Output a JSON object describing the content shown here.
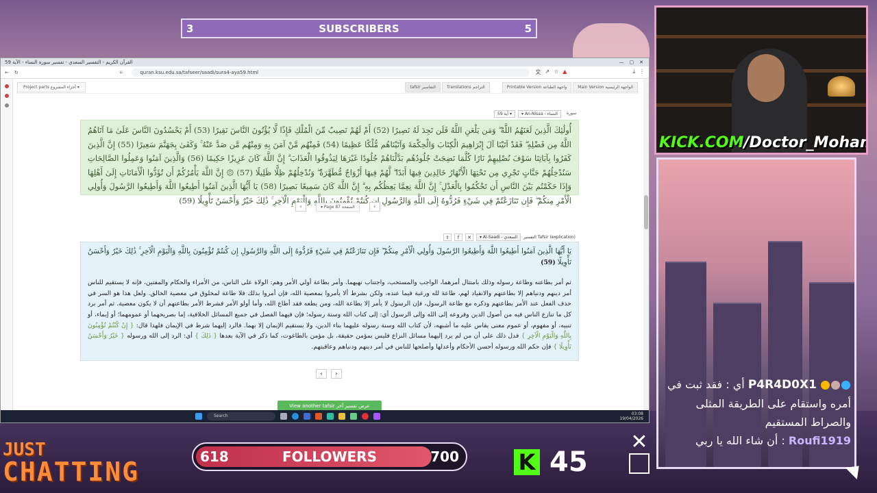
{
  "overlay": {
    "subscribers": {
      "current": "3",
      "label": "SUBSCRIBERS",
      "goal": "5"
    },
    "followers": {
      "current": "618",
      "label": "FOLLOWERS",
      "goal": "700",
      "progress": 0.883
    },
    "just_chatting": {
      "line1": "JUST",
      "line2": "CHATTING"
    },
    "viewer_count": "45",
    "webcam_handle": {
      "kick": "KICK.COM",
      "name": "/Doctor_Mohamed"
    },
    "chat": [
      {
        "user": "P4R4D0X1",
        "message": "أي : فقد ثبت في أمره واستقام على الطريقة المثلى والصراط المستقيم"
      },
      {
        "user": "Roufi1919",
        "message": "أن شاء الله يا ربي"
      }
    ]
  },
  "browser": {
    "tab_title": "القرآن الكريم - التفسير السعدي - تفسير سورة النساء - الآية 59",
    "url": "quran.ksu.edu.sa/tafseer/saadi/sura4-aya59.html",
    "nav": {
      "project_parts": "Project parts أجزاء المشروع ▾",
      "tafsir_tab": "tafsir التفاسير",
      "translations_tab": "Translations التراجم",
      "printable_tab": "Printable Version واجهة الطباعة",
      "main_tab": "Main Version الواجهة الرئيسية"
    },
    "verse_controls": {
      "verse": "آية 59 ▾",
      "sura": "▾ An-Nisaa - النساء",
      "sura_label": "سورة"
    },
    "quran_text": "أُولَٰئِكَ الَّذِينَ لَعَنَهُمُ اللَّهُ ۖ وَمَن يَلْعَنِ اللَّهُ فَلَن تَجِدَ لَهُ نَصِيرًا (52) أَمْ لَهُمْ نَصِيبٌ مِّنَ الْمُلْكِ فَإِذًا لَّا يُؤْتُونَ النَّاسَ نَقِيرًا (53) أَمْ يَحْسُدُونَ النَّاسَ عَلَىٰ مَا آتَاهُمُ اللَّهُ مِن فَضْلِهِ ۖ فَقَدْ آتَيْنَا آلَ إِبْرَاهِيمَ الْكِتَابَ وَالْحِكْمَةَ وَآتَيْنَاهُم مُّلْكًا عَظِيمًا (54) فَمِنْهُم مَّنْ آمَنَ بِهِ وَمِنْهُم مَّن صَدَّ عَنْهُ ۚ وَكَفَىٰ بِجَهَنَّمَ سَعِيرًا (55) إِنَّ الَّذِينَ كَفَرُوا بِآيَاتِنَا سَوْفَ نُصْلِيهِمْ نَارًا كُلَّمَا نَضِجَتْ جُلُودُهُم بَدَّلْنَاهُمْ جُلُودًا غَيْرَهَا لِيَذُوقُوا الْعَذَابَ ۗ إِنَّ اللَّهَ كَانَ عَزِيزًا حَكِيمًا (56) وَالَّذِينَ آمَنُوا وَعَمِلُوا الصَّالِحَاتِ سَنُدْخِلُهُمْ جَنَّاتٍ تَجْرِي مِن تَحْتِهَا الْأَنْهَارُ خَالِدِينَ فِيهَا أَبَدًا ۖ لَّهُمْ فِيهَا أَزْوَاجٌ مُّطَهَّرَةٌ ۖ وَنُدْخِلُهُمْ ظِلًّا ظَلِيلًا (57) ۞ إِنَّ اللَّهَ يَأْمُرُكُمْ أَن تُؤَدُّوا الْأَمَانَاتِ إِلَىٰ أَهْلِهَا وَإِذَا حَكَمْتُم بَيْنَ النَّاسِ أَن تَحْكُمُوا بِالْعَدْلِ ۚ إِنَّ اللَّهَ نِعِمَّا يَعِظُكُم بِهِ ۗ إِنَّ اللَّهَ كَانَ سَمِيعًا بَصِيرًا (58) يَا أَيُّهَا الَّذِينَ آمَنُوا أَطِيعُوا اللَّهَ وَأَطِيعُوا الرَّسُولَ وَأُولِي الْأَمْرِ مِنكُمْ ۖ فَإِن تَنَازَعْتُمْ فِي شَيْءٍ فَرُدُّوهُ إِلَى اللَّهِ وَالرَّسُولِ إِن كُنتُمْ تُؤْمِنُونَ بِاللَّهِ وَالْيَوْمِ الْآخِرِ ۚ ذَٰلِكَ خَيْرٌ وَأَحْسَنُ تَأْوِيلًا (59)",
    "page_selector": "▾ Page 87 الصفحة",
    "tafsir_header": {
      "label": "التفسير Tafsir (explication)",
      "selected": "▾ Al-Saadi - السعدي"
    },
    "tafsir_verse": "يَا أَيُّهَا الَّذِينَ آمَنُوا أَطِيعُوا اللَّهَ وَأَطِيعُوا الرَّسُولَ وَأُولِي الْأَمْرِ مِنكُمْ ۖ فَإِن تَنَازَعْتُمْ فِي شَيْءٍ فَرُدُّوهُ إِلَى اللَّهِ وَالرَّسُولِ إِن كُنتُمْ تُؤْمِنُونَ بِاللَّهِ وَالْيَوْمِ الْآخِرِ ۚ ذَٰلِكَ خَيْرٌ وَأَحْسَنُ تَأْوِيلًا",
    "tafsir_verse_num": "(59)",
    "tafsir_body_1": "ثم أمر بطاعته وطاعة رسوله وذلك بامتثال أمرهما، الواجب والمستحب، واجتناب نهيهما. وأمر بطاعة أولي الأمر وهم: الولاة على الناس، من الأمراء والحكام والمفتين، فإنه لا يستقيم للناس أمر دينهم ودنياهم إلا بطاعتهم والانقياد لهم، طاعة لله ورغبة فيما عنده، ولكن بشرط ألا يأمروا بمعصية الله، فإن أمروا بذلك فلا طاعة لمخلوق في معصية الخالق. ولعل هذا هو السر في حذف الفعل عند الأمر بطاعتهم وذكره مع طاعة الرسول، فإن الرسول لا يأمر إلا بطاعة الله، ومن يطعه فقد أطاع الله، وأما أولو الأمر فشرط الأمر بطاعتهم أن لا يكون معصية. ثم أمر برد كل ما تنازع الناس فيه من أصول الدين وفروعه إلى الله وإلى الرسول أي: إلى كتاب الله وسنة رسوله؛ فإن فيهما الفصل في جميع المسائل الخلافية، إما بصريحهما أو عمومهما؛ أو إيماء، أو تنبيه، أو مفهوم، أو عموم معنى يقاس عليه ما أشبهه، لأن كتاب الله وسنة رسوله عليهما بناء الدين، ولا يستقيم الإيمان إلا بهما. فالرد إليهما شرط في الإيمان فلهذا قال:",
    "tafsir_quote_1": "{ إِنْ كُنْتُمْ تُؤْمِنُونَ بِاللَّهِ وَالْيَوْمِ الْآخِرِ }",
    "tafsir_body_2": "فدل ذلك على أن من لم يرد إليهما مسائل النزاع فليس بمؤمن حقيقة، بل مؤمن بالطاغوت، كما ذكر في الآية بعدها",
    "tafsir_quote_2": "{ ذَلِكَ }",
    "tafsir_body_3": "أي: الرد إلى الله ورسوله",
    "tafsir_quote_3": "{ خَيْرٌ وَأَحْسَنُ تَأْوِيلًا }",
    "tafsir_body_4": "فإن حكم الله ورسوله أحسن الأحكام وأعدلها وأصلحها للناس في أمر دينهم ودنياهم وعاقبتهم.",
    "another_tafsir": "View another tafsir عرض تفسير آخر",
    "taskbar": {
      "search": "Search",
      "time": "03:08",
      "date": "19/04/2026"
    }
  }
}
